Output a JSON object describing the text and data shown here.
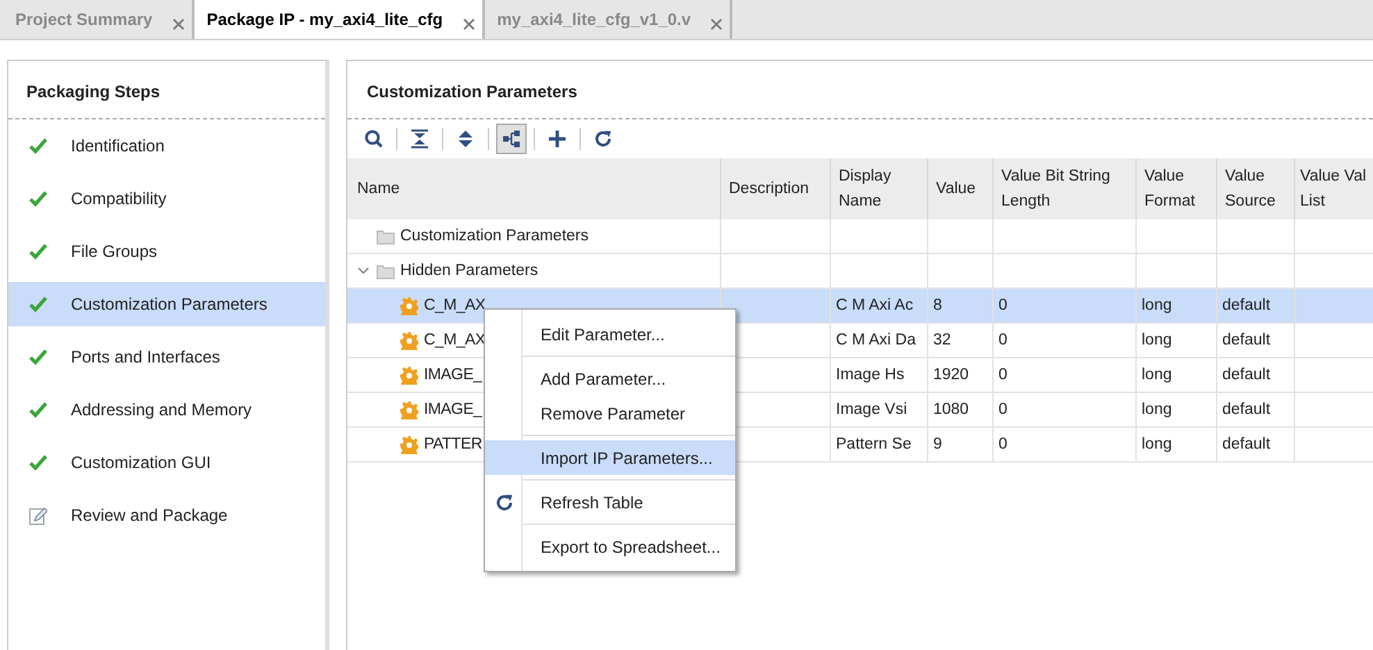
{
  "tabs": [
    {
      "label": "Project Summary",
      "selected": false
    },
    {
      "label": "Package IP - my_axi4_lite_cfg",
      "selected": true
    },
    {
      "label": "my_axi4_lite_cfg_v1_0.v",
      "selected": false
    }
  ],
  "steps": {
    "title": "Packaging Steps",
    "items": [
      {
        "label": "Identification",
        "kind": "done",
        "selected": false
      },
      {
        "label": "Compatibility",
        "kind": "done",
        "selected": false
      },
      {
        "label": "File Groups",
        "kind": "done",
        "selected": false
      },
      {
        "label": "Customization Parameters",
        "kind": "done",
        "selected": true
      },
      {
        "label": "Ports and Interfaces",
        "kind": "done",
        "selected": false
      },
      {
        "label": "Addressing and Memory",
        "kind": "done",
        "selected": false
      },
      {
        "label": "Customization GUI",
        "kind": "done",
        "selected": false
      },
      {
        "label": "Review and Package",
        "kind": "pending",
        "selected": false
      }
    ]
  },
  "parameters": {
    "title": "Customization Parameters",
    "toolbar": [
      {
        "kind": "search",
        "pressed": false
      },
      {
        "kind": "collapse",
        "pressed": false
      },
      {
        "kind": "expand",
        "pressed": false
      },
      {
        "kind": "hierarchy",
        "pressed": true
      },
      {
        "kind": "add",
        "pressed": false
      },
      {
        "kind": "refresh",
        "pressed": false
      }
    ],
    "columns": [
      "Name",
      "Description",
      "Display Name",
      "Value",
      "Value Bit String Length",
      "Value Format",
      "Value Source",
      "Value Val List"
    ],
    "rows": [
      {
        "kind": "group",
        "name": "Customization Parameters",
        "expanded": false,
        "children": []
      },
      {
        "kind": "group",
        "name": "Hidden Parameters",
        "expanded": true,
        "children": [
          {
            "kind": "param",
            "name": "C_M_AX",
            "display_name": "C M Axi Ac",
            "value": "8",
            "bit_length": "0",
            "format": "long",
            "source": "default",
            "selected": true
          },
          {
            "kind": "param",
            "name": "C_M_AX",
            "display_name": "C M Axi Da",
            "value": "32",
            "bit_length": "0",
            "format": "long",
            "source": "default",
            "selected": false
          },
          {
            "kind": "param",
            "name": "IMAGE_",
            "display_name": "Image Hs",
            "value": "1920",
            "bit_length": "0",
            "format": "long",
            "source": "default",
            "selected": false
          },
          {
            "kind": "param",
            "name": "IMAGE_",
            "display_name": "Image Vsi",
            "value": "1080",
            "bit_length": "0",
            "format": "long",
            "source": "default",
            "selected": false
          },
          {
            "kind": "param",
            "name": "PATTER",
            "display_name": "Pattern Se",
            "value": "9",
            "bit_length": "0",
            "format": "long",
            "source": "default",
            "selected": false
          }
        ]
      }
    ]
  },
  "context_menu": {
    "groups": [
      [
        {
          "label": "Edit Parameter...",
          "kind": "plain",
          "selected": false
        }
      ],
      [
        {
          "label": "Add Parameter...",
          "kind": "plain",
          "selected": false
        },
        {
          "label": "Remove Parameter",
          "kind": "plain",
          "selected": false
        }
      ],
      [
        {
          "label": "Import IP Parameters...",
          "kind": "plain",
          "selected": true
        }
      ],
      [
        {
          "label": "Refresh Table",
          "kind": "refresh",
          "selected": false
        }
      ],
      [
        {
          "label": "Export to Spreadsheet...",
          "kind": "plain",
          "selected": false
        }
      ]
    ]
  }
}
